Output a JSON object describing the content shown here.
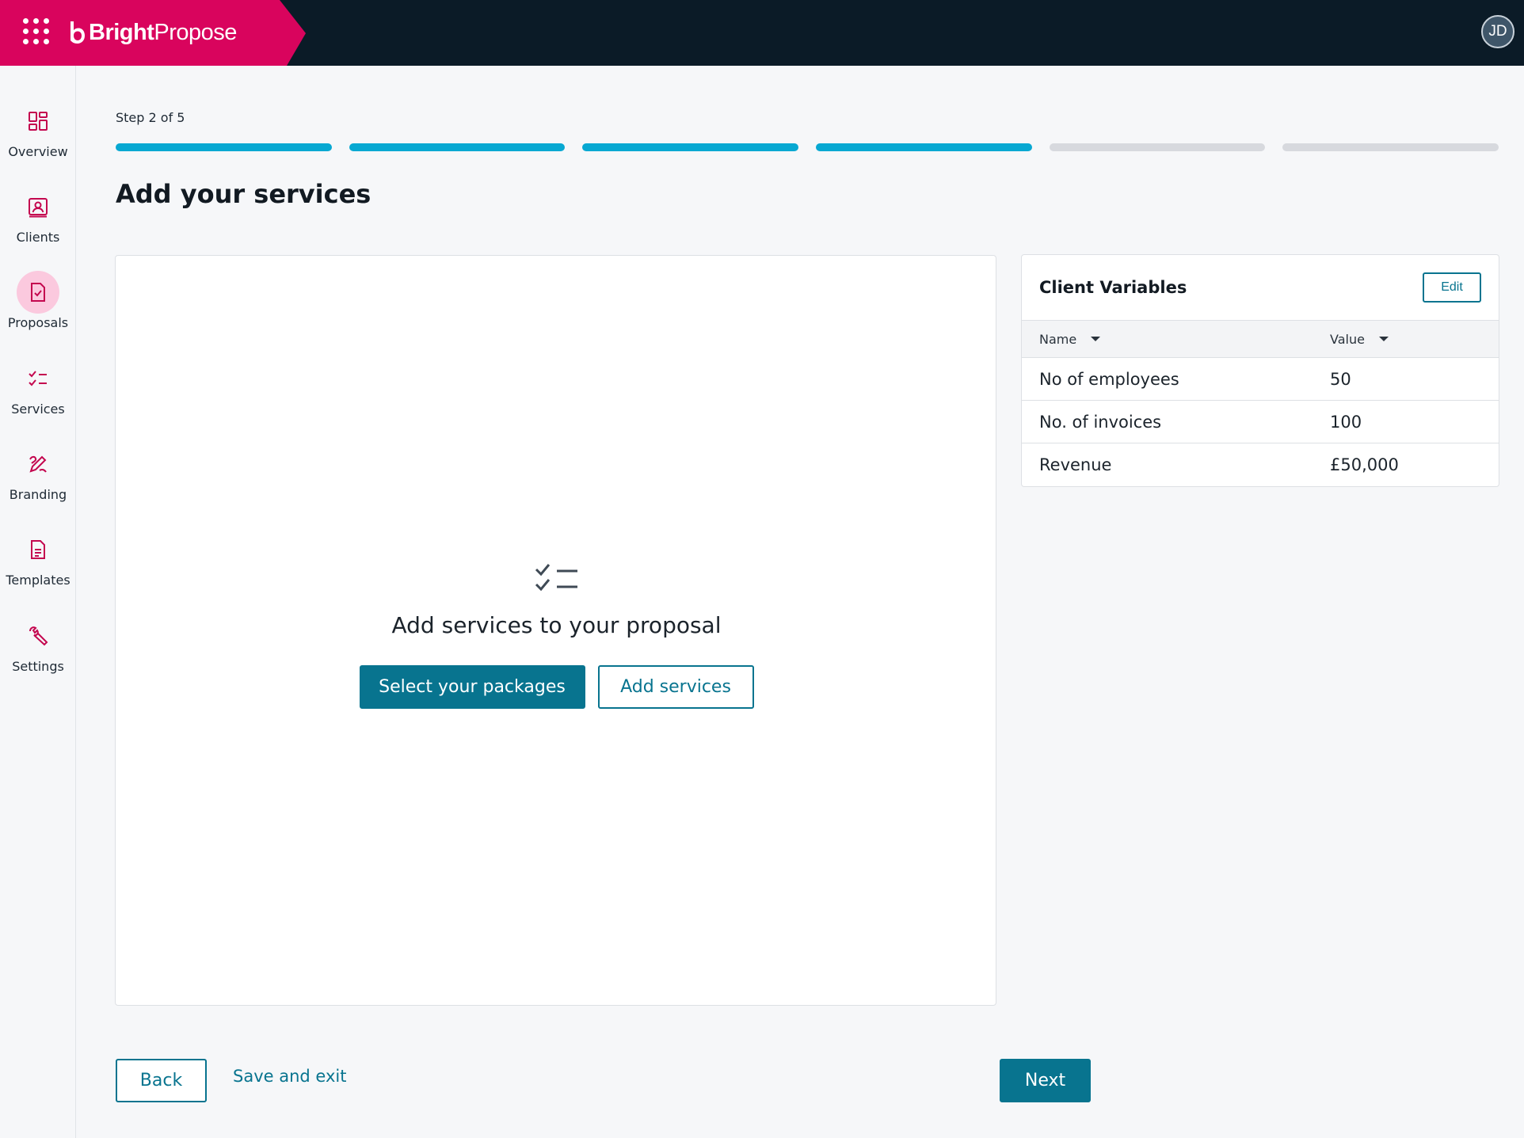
{
  "app": {
    "brand_bold": "Bright",
    "brand_light": "Propose",
    "user_initials": "JD",
    "icons": {
      "apps": "grid-dots-icon",
      "logo": "bright-b-logo-icon"
    }
  },
  "colors": {
    "brand_pink": "#d9045d",
    "topbar_navy": "#0b1b27",
    "accent_teal": "#08748f",
    "progress_cyan": "#07a8d2",
    "progress_gray": "#d7d9de",
    "active_nav_bg": "#fbc9de"
  },
  "sidebar": {
    "items": [
      {
        "label": "Overview",
        "icon": "dashboard-grid-icon",
        "active": false
      },
      {
        "label": "Clients",
        "icon": "contact-card-icon",
        "active": false
      },
      {
        "label": "Proposals",
        "icon": "document-check-icon",
        "active": true
      },
      {
        "label": "Services",
        "icon": "checklist-icon",
        "active": false
      },
      {
        "label": "Branding",
        "icon": "pencil-brush-icon",
        "active": false
      },
      {
        "label": "Templates",
        "icon": "document-lines-icon",
        "active": false
      },
      {
        "label": "Settings",
        "icon": "wrench-icon",
        "active": false
      }
    ]
  },
  "wizard": {
    "step_label": "Step 2 of 5",
    "steps_total": 6,
    "steps_completed": 4,
    "title": "Add your services"
  },
  "services": {
    "empty_icon": "checklist-icon",
    "empty_title": "Add services to your proposal",
    "select_packages_label": "Select your packages",
    "add_services_label": "Add services"
  },
  "client_variables": {
    "title": "Client Variables",
    "edit_label": "Edit",
    "columns": [
      "Name",
      "Value"
    ],
    "rows": [
      {
        "name": "No of employees",
        "value": "50"
      },
      {
        "name": "No. of invoices",
        "value": "100"
      },
      {
        "name": "Revenue",
        "value": "£50,000"
      }
    ]
  },
  "footer": {
    "back_label": "Back",
    "save_exit_label": "Save and exit",
    "next_label": "Next"
  }
}
